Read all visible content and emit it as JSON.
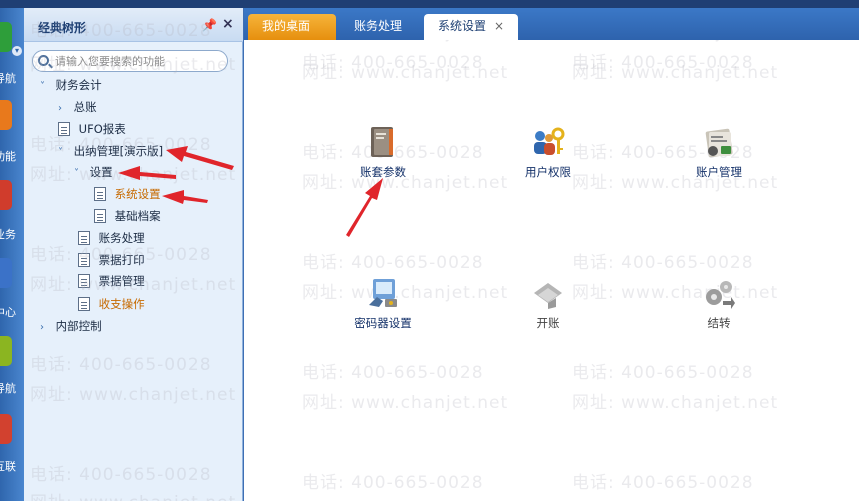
{
  "rail": {
    "items": [
      {
        "label": "导航",
        "color": "#2e9e3a"
      },
      {
        "label": "功能",
        "color": "#e8791c"
      },
      {
        "label": "业务",
        "color": "#d03c2c"
      },
      {
        "label": "中心",
        "color": "#3b72c8"
      },
      {
        "label": "导航",
        "color": "#8bb521"
      },
      {
        "label": "互联",
        "color": "#d2412f"
      }
    ]
  },
  "tree": {
    "title": "经典树形",
    "search_placeholder": "请输入您要搜索的功能",
    "nodes": [
      {
        "label": "财务会计",
        "arrow": "˅"
      },
      {
        "label": "总账",
        "arrow": "›"
      },
      {
        "label": "UFO报表",
        "arrow": ""
      },
      {
        "label": "出纳管理[演示版]",
        "arrow": "˅"
      },
      {
        "label": "设置",
        "arrow": "˅"
      },
      {
        "label": "系统设置",
        "arrow": ""
      },
      {
        "label": "基础档案",
        "arrow": ""
      },
      {
        "label": "账务处理",
        "arrow": ""
      },
      {
        "label": "票据打印",
        "arrow": ""
      },
      {
        "label": "票据管理",
        "arrow": ""
      },
      {
        "label": "收支操作",
        "arrow": ""
      },
      {
        "label": "内部控制",
        "arrow": "›"
      }
    ]
  },
  "tabs": {
    "home": "我的桌面",
    "ledger": "账务处理",
    "settings": "系统设置",
    "close_symbol": "×"
  },
  "functions": {
    "account_params": "账套参数",
    "user_permissions": "用户权限",
    "account_management": "账户管理",
    "token_settings": "密码器设置",
    "open_account": "开账",
    "carry_forward": "结转"
  },
  "watermark": {
    "phone": "电话: 400-665-0028",
    "site": "网址: www.chanjet.net"
  },
  "colors": {
    "accent_orange": "#e68f0e",
    "tab_blue": "#2e63ad",
    "annotation_red": "#e0252b",
    "active_node": "#c76a00"
  }
}
